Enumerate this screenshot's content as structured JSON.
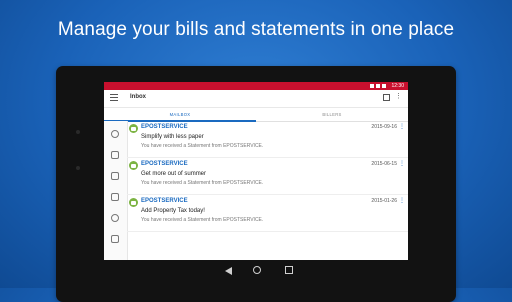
{
  "headline": "Manage your bills and statements in one place",
  "statusbar": {
    "time": "12:30"
  },
  "toolbar": {
    "title": "Inbox",
    "menu_icon": "hamburger-icon",
    "square_icon": "select-icon",
    "overflow_icon": "more-vertical-icon"
  },
  "tabs": [
    {
      "label": "MAILBOX",
      "active": true
    },
    {
      "label": "BILLERS",
      "active": false
    }
  ],
  "rail_icons": [
    "target-icon",
    "document-icon",
    "calendar-check-icon",
    "truck-icon",
    "sync-icon",
    "file-gear-icon"
  ],
  "messages": [
    {
      "sender": "EPOSTSERVICE",
      "date": "2015-09-16",
      "subject": "Simplify with less paper",
      "preview": "You have received a Statement from EPOSTSERVICE."
    },
    {
      "sender": "EPOSTSERVICE",
      "date": "2015-06-15",
      "subject": "Get more out of summer",
      "preview": "You have received a Statement from EPOSTSERVICE."
    },
    {
      "sender": "EPOSTSERVICE",
      "date": "2015-01-26",
      "subject": "Add Property Tax today!",
      "preview": "You have received a Statement from EPOSTSERVICE."
    }
  ],
  "colors": {
    "background": "#1a62b8",
    "status_bar": "#c8102e",
    "accent": "#1a6ac0",
    "avatar": "#7cb342"
  }
}
